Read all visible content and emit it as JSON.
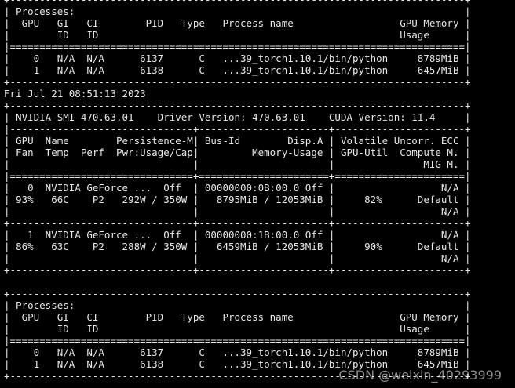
{
  "terminal": {
    "lines": [
      "+-----------------------------------------------------------------------------+",
      "| Processes:                                                                  |",
      "|  GPU   GI   CI        PID   Type   Process name                  GPU Memory |",
      "|        ID   ID                                                   Usage      |",
      "|=============================================================================|",
      "|    0   N/A  N/A      6137      C   ...39_torch1.10.1/bin/python     8789MiB |",
      "|    1   N/A  N/A      6138      C   ...39_torch1.10.1/bin/python     6457MiB |",
      "+-----------------------------------------------------------------------------+",
      "Fri Jul 21 08:51:13 2023",
      "+-----------------------------------------------------------------------------+",
      "| NVIDIA-SMI 470.63.01    Driver Version: 470.63.01    CUDA Version: 11.4     |",
      "|-------------------------------+----------------------+----------------------+",
      "| GPU  Name        Persistence-M| Bus-Id        Disp.A | Volatile Uncorr. ECC |",
      "| Fan  Temp  Perf  Pwr:Usage/Cap|         Memory-Usage | GPU-Util  Compute M. |",
      "|                               |                      |               MIG M. |",
      "|===============================+======================+======================|",
      "|   0  NVIDIA GeForce ...  Off  | 00000000:0B:00.0 Off |                  N/A |",
      "| 93%   66C    P2   292W / 350W |   8795MiB / 12053MiB |     82%      Default |",
      "|                               |                      |                  N/A |",
      "+-------------------------------+----------------------+----------------------+",
      "|   1  NVIDIA GeForce ...  Off  | 00000000:1B:00.0 Off |                  N/A |",
      "| 86%   63C    P2   288W / 350W |   6459MiB / 12053MiB |     90%      Default |",
      "|                               |                      |                  N/A |",
      "+-------------------------------+----------------------+----------------------+",
      "",
      "+-----------------------------------------------------------------------------+",
      "| Processes:                                                                  |",
      "|  GPU   GI   CI        PID   Type   Process name                  GPU Memory |",
      "|        ID   ID                                                   Usage      |",
      "|=============================================================================|",
      "|    0   N/A  N/A      6137      C   ...39_torch1.10.1/bin/python     8789MiB |",
      "|    1   N/A  N/A      6138      C   ...39_torch1.10.1/bin/python     6457MiB |",
      "+-----------------------------------------------------------------------------+"
    ]
  },
  "watermark": {
    "text": "CSDN @weixin_40293999"
  },
  "colors": {
    "background": "#000000",
    "text": "#e6e6e6"
  }
}
